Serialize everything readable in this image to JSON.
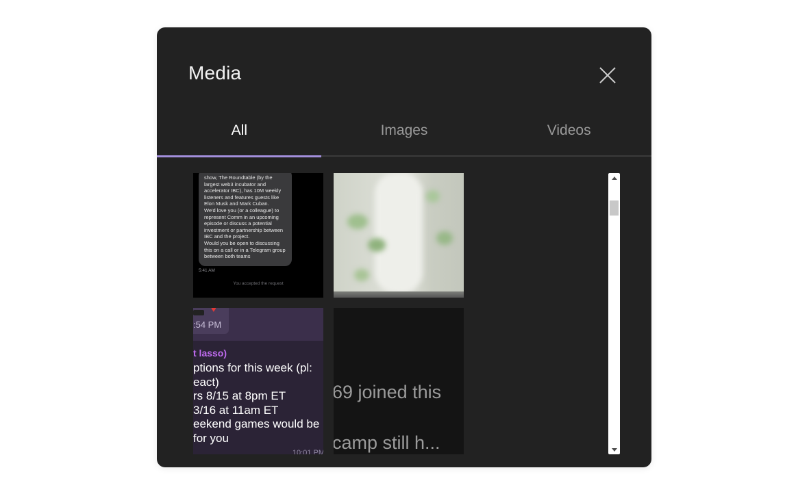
{
  "modal": {
    "title": "Media",
    "close_icon": "close-icon"
  },
  "tabs": [
    {
      "label": "All",
      "active": true
    },
    {
      "label": "Images",
      "active": false
    },
    {
      "label": "Videos",
      "active": false
    }
  ],
  "colors": {
    "modal_bg": "#222222",
    "active_tab_indicator": "#a38fdc",
    "inactive_tab_text": "#9a9a9a",
    "author_name": "#c06cf0"
  },
  "media": [
    {
      "kind": "chat-screenshot",
      "bubble_lines": [
        "show, The Roundtable (by the",
        "largest web3 incubator and",
        "accelerator IBC), has 10M weekly",
        "listeners and features guests like",
        "Elon Musk and Mark Cuban.",
        "We'd love you (or a colleague) to",
        "represent Comm in an upcoming",
        "episode or discuss a potential",
        "investment or partnership between",
        "IBC and the project.",
        "Would you be open to discussing",
        "this on a call or in a Telegram group",
        "between both teams"
      ],
      "time": "5:41 AM",
      "footer": "You accepted the request"
    },
    {
      "kind": "blurred-photo"
    },
    {
      "kind": "chat-screenshot",
      "time_top": ":54 PM",
      "author": "t lasso)",
      "message_lines": [
        "ptions for this week (pl:",
        "eact)",
        "rs 8/15 at 8pm ET",
        "3/16 at 11am ET",
        "eekend games would be",
        "for you"
      ],
      "time_bottom": "10:01 PM"
    },
    {
      "kind": "text-screenshot",
      "lines": [
        "69 joined this",
        "camp still h..."
      ]
    }
  ],
  "scrollbar": {
    "up_icon": "arrow-up-icon",
    "down_icon": "arrow-down-icon"
  }
}
